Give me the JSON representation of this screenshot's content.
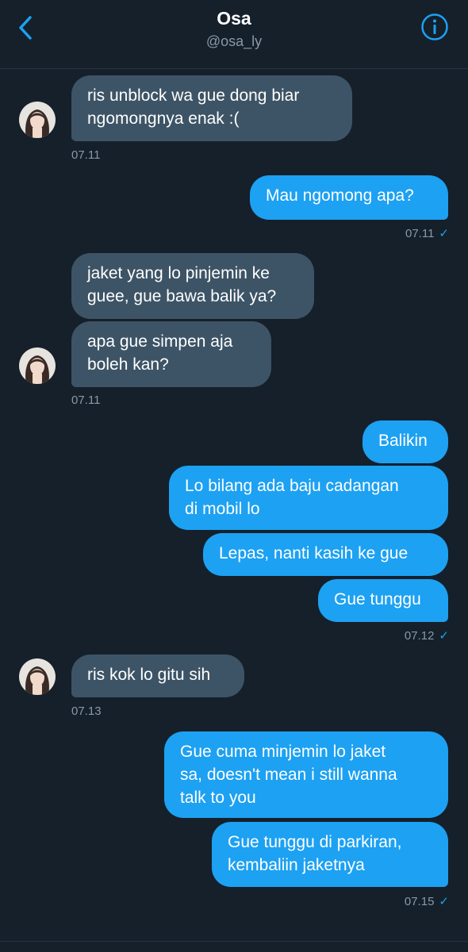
{
  "header": {
    "title": "Osa",
    "handle": "@osa_ly",
    "back_icon": "chevron-left-icon",
    "info_icon": "info-icon",
    "accent": "#1da1f2"
  },
  "messages": [
    {
      "from": "in",
      "text": [
        "ris unblock wa gue dong biar",
        "ngomongnya enak :("
      ]
    },
    {
      "from": "in",
      "time": "07.11"
    },
    {
      "from": "out",
      "text": [
        "Mau ngomong apa?"
      ]
    },
    {
      "from": "out",
      "time": "07.11"
    },
    {
      "from": "in",
      "text": [
        "jaket yang lo pinjemin ke",
        "guee, gue bawa balik ya?"
      ]
    },
    {
      "from": "in",
      "text": [
        "apa gue simpen aja",
        "boleh kan?"
      ]
    },
    {
      "from": "in",
      "time": "07.11"
    },
    {
      "from": "out",
      "text": [
        "Balikin"
      ]
    },
    {
      "from": "out",
      "text": [
        "Lo bilang ada baju cadangan",
        "di mobil lo"
      ]
    },
    {
      "from": "out",
      "text": [
        "Lepas, nanti kasih ke gue"
      ]
    },
    {
      "from": "out",
      "text": [
        "Gue tunggu"
      ]
    },
    {
      "from": "out",
      "time": "07.12"
    },
    {
      "from": "in",
      "text": [
        "ris kok lo gitu sih"
      ]
    },
    {
      "from": "in",
      "time": "07.13"
    },
    {
      "from": "out",
      "text": [
        "Gue cuma minjemin lo jaket",
        "sa, doesn't mean i still wanna",
        "talk to you"
      ]
    },
    {
      "from": "out",
      "text": [
        "Gue tunggu di parkiran,",
        "kembaliin jaketnya"
      ]
    },
    {
      "from": "out",
      "time": "07.15"
    }
  ],
  "read_receipt_glyph": "✓",
  "colors": {
    "background": "#15202b",
    "incoming_bubble": "#3d5466",
    "outgoing_bubble": "#1da1f2",
    "meta_text": "#8899a6"
  }
}
